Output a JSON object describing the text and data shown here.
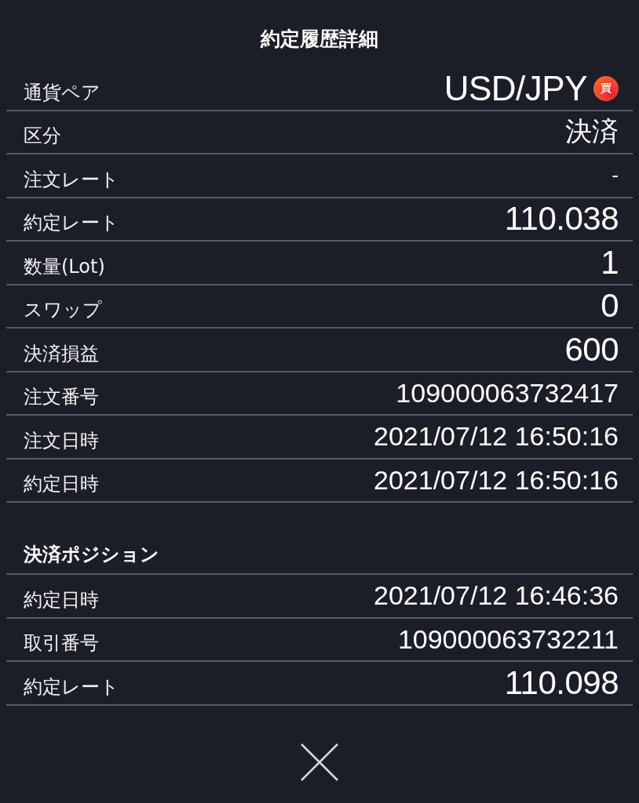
{
  "title": "約定履歴詳細",
  "rows": [
    {
      "label": "通貨ペア",
      "value": "USD/JPY",
      "kind": "pair",
      "badge": "買"
    },
    {
      "label": "区分",
      "value": "決済",
      "kind": "text"
    },
    {
      "label": "注文レート",
      "value": "-",
      "kind": "small"
    },
    {
      "label": "約定レート",
      "value": "110.038",
      "kind": "large"
    },
    {
      "label": "数量(Lot)",
      "value": "1",
      "kind": "large"
    },
    {
      "label": "スワップ",
      "value": "0",
      "kind": "large"
    },
    {
      "label": "決済損益",
      "value": "600",
      "kind": "large"
    },
    {
      "label": "注文番号",
      "value": "109000063732417",
      "kind": "medium"
    },
    {
      "label": "注文日時",
      "value": "2021/07/12 16:50:16",
      "kind": "medium"
    },
    {
      "label": "約定日時",
      "value": "2021/07/12 16:50:16",
      "kind": "medium"
    }
  ],
  "section": {
    "title": "決済ポジション",
    "rows": [
      {
        "label": "約定日時",
        "value": "2021/07/12 16:46:36",
        "kind": "medium"
      },
      {
        "label": "取引番号",
        "value": "109000063732211",
        "kind": "medium"
      },
      {
        "label": "約定レート",
        "value": "110.098",
        "kind": "large"
      }
    ]
  }
}
